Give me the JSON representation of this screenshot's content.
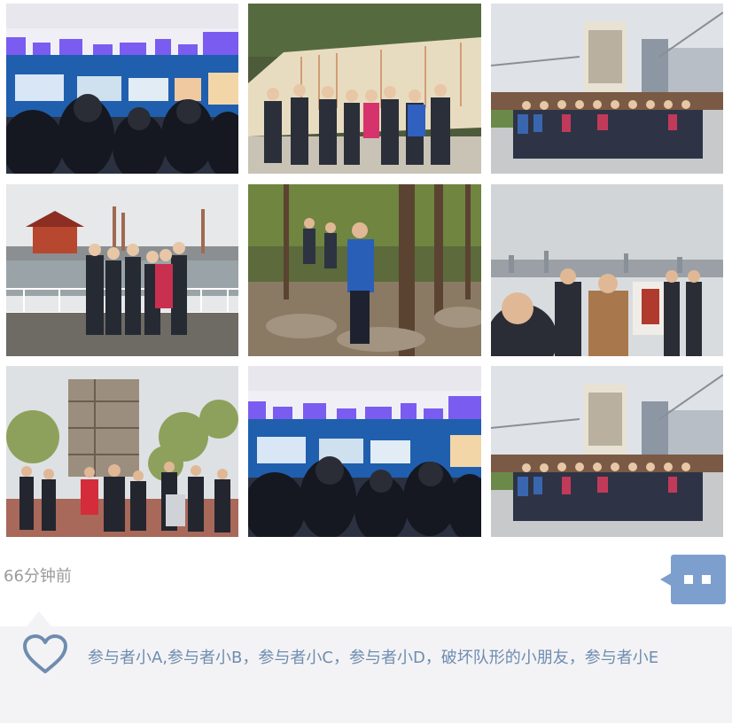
{
  "post": {
    "time_ago": "66分钟前",
    "likes_text": "参与者小A,参与者小B，参与者小C，参与者小D，破坏队形的小朋友，参与者小E"
  },
  "icons": {
    "comment": "comment-icon",
    "like": "heart-outline-icon"
  },
  "colors": {
    "accent": "#6f8cb0",
    "comment_button": "#7d9fce",
    "panel_bg": "#f3f3f5",
    "timestamp": "#9b9b9b"
  }
}
